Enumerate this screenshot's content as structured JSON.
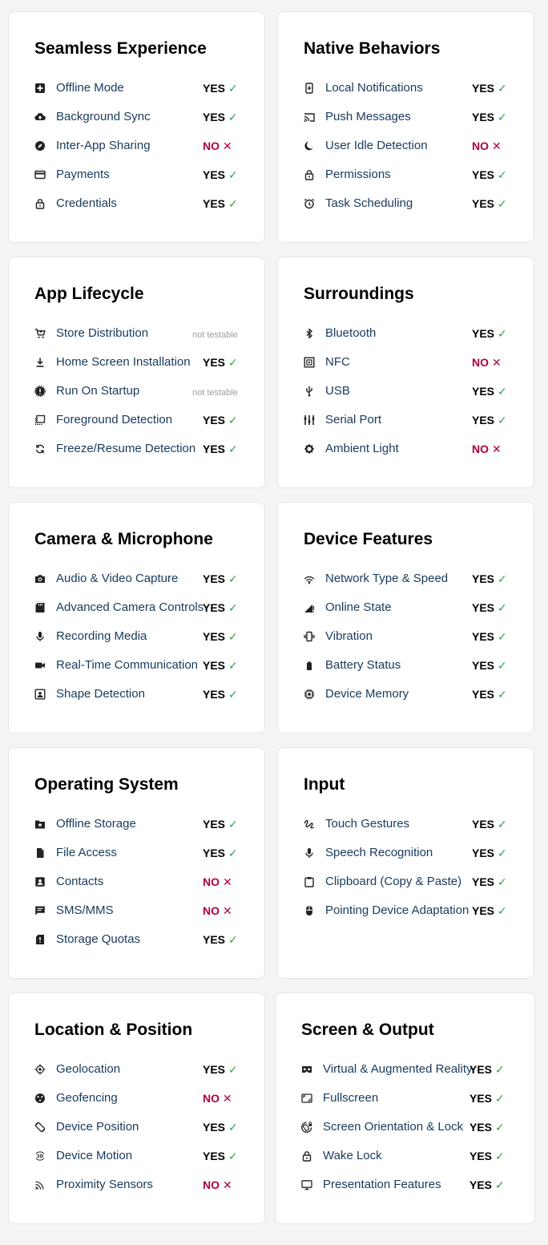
{
  "colors": {
    "yes": "#000000",
    "check": "#2e9e4f",
    "no": "#b0003a",
    "label": "#183a5c",
    "not_testable": "#9aa0a6"
  },
  "cards": [
    {
      "title": "Seamless Experience",
      "items": [
        {
          "icon": "offline-mode-icon",
          "label": "Offline Mode",
          "status": "YES",
          "mark": "✓"
        },
        {
          "icon": "cloud-upload-icon",
          "label": "Background Sync",
          "status": "YES",
          "mark": "✓"
        },
        {
          "icon": "compass-icon",
          "label": "Inter-App Sharing",
          "status": "NO",
          "mark": "✕"
        },
        {
          "icon": "credit-card-icon",
          "label": "Payments",
          "status": "YES",
          "mark": "✓"
        },
        {
          "icon": "lock-icon",
          "label": "Credentials",
          "status": "YES",
          "mark": "✓"
        }
      ]
    },
    {
      "title": "Native Behaviors",
      "items": [
        {
          "icon": "phone-notification-icon",
          "label": "Local Notifications",
          "status": "YES",
          "mark": "✓"
        },
        {
          "icon": "cast-icon",
          "label": "Push Messages",
          "status": "YES",
          "mark": "✓"
        },
        {
          "icon": "moon-icon",
          "label": "User Idle Detection",
          "status": "NO",
          "mark": "✕"
        },
        {
          "icon": "lock-icon",
          "label": "Permissions",
          "status": "YES",
          "mark": "✓"
        },
        {
          "icon": "alarm-clock-icon",
          "label": "Task Scheduling",
          "status": "YES",
          "mark": "✓"
        }
      ]
    },
    {
      "title": "App Lifecycle",
      "items": [
        {
          "icon": "cart-icon",
          "label": "Store Distribution",
          "status": "not testable",
          "mark": ""
        },
        {
          "icon": "download-icon",
          "label": "Home Screen Installation",
          "status": "YES",
          "mark": "✓"
        },
        {
          "icon": "badge-icon",
          "label": "Run On Startup",
          "status": "not testable",
          "mark": ""
        },
        {
          "icon": "window-icon",
          "label": "Foreground Detection",
          "status": "YES",
          "mark": "✓"
        },
        {
          "icon": "refresh-icon",
          "label": "Freeze/Resume Detection",
          "status": "YES",
          "mark": "✓"
        }
      ]
    },
    {
      "title": "Surroundings",
      "items": [
        {
          "icon": "bluetooth-icon",
          "label": "Bluetooth",
          "status": "YES",
          "mark": "✓"
        },
        {
          "icon": "nfc-icon",
          "label": "NFC",
          "status": "NO",
          "mark": "✕"
        },
        {
          "icon": "usb-icon",
          "label": "USB",
          "status": "YES",
          "mark": "✓"
        },
        {
          "icon": "serial-port-icon",
          "label": "Serial Port",
          "status": "YES",
          "mark": "✓"
        },
        {
          "icon": "sun-icon",
          "label": "Ambient Light",
          "status": "NO",
          "mark": "✕"
        }
      ]
    },
    {
      "title": "Camera & Microphone",
      "items": [
        {
          "icon": "camera-icon",
          "label": "Audio & Video Capture",
          "status": "YES",
          "mark": "✓"
        },
        {
          "icon": "sd-card-icon",
          "label": "Advanced Camera Controls",
          "status": "YES",
          "mark": "✓"
        },
        {
          "icon": "microphone-icon",
          "label": "Recording Media",
          "status": "YES",
          "mark": "✓"
        },
        {
          "icon": "video-camera-icon",
          "label": "Real-Time Communication",
          "status": "YES",
          "mark": "✓"
        },
        {
          "icon": "face-frame-icon",
          "label": "Shape Detection",
          "status": "YES",
          "mark": "✓"
        }
      ]
    },
    {
      "title": "Device Features",
      "items": [
        {
          "icon": "wifi-signal-icon",
          "label": "Network Type & Speed",
          "status": "YES",
          "mark": "✓"
        },
        {
          "icon": "cellular-icon",
          "label": "Online State",
          "status": "YES",
          "mark": "✓"
        },
        {
          "icon": "vibration-icon",
          "label": "Vibration",
          "status": "YES",
          "mark": "✓"
        },
        {
          "icon": "battery-icon",
          "label": "Battery Status",
          "status": "YES",
          "mark": "✓"
        },
        {
          "icon": "chip-icon",
          "label": "Device Memory",
          "status": "YES",
          "mark": "✓"
        }
      ]
    },
    {
      "title": "Operating System",
      "items": [
        {
          "icon": "folder-star-icon",
          "label": "Offline Storage",
          "status": "YES",
          "mark": "✓"
        },
        {
          "icon": "file-icon",
          "label": "File Access",
          "status": "YES",
          "mark": "✓"
        },
        {
          "icon": "contact-icon",
          "label": "Contacts",
          "status": "NO",
          "mark": "✕"
        },
        {
          "icon": "message-icon",
          "label": "SMS/MMS",
          "status": "NO",
          "mark": "✕"
        },
        {
          "icon": "storage-alert-icon",
          "label": "Storage Quotas",
          "status": "YES",
          "mark": "✓"
        }
      ]
    },
    {
      "title": "Input",
      "items": [
        {
          "icon": "gesture-icon",
          "label": "Touch Gestures",
          "status": "YES",
          "mark": "✓"
        },
        {
          "icon": "microphone-icon",
          "label": "Speech Recognition",
          "status": "YES",
          "mark": "✓"
        },
        {
          "icon": "clipboard-icon",
          "label": "Clipboard (Copy & Paste)",
          "status": "YES",
          "mark": "✓"
        },
        {
          "icon": "mouse-icon",
          "label": "Pointing Device Adaptation",
          "status": "YES",
          "mark": "✓"
        }
      ]
    },
    {
      "title": "Location & Position",
      "items": [
        {
          "icon": "crosshair-icon",
          "label": "Geolocation",
          "status": "YES",
          "mark": "✓"
        },
        {
          "icon": "geofence-icon",
          "label": "Geofencing",
          "status": "NO",
          "mark": "✕"
        },
        {
          "icon": "screen-rotation-icon",
          "label": "Device Position",
          "status": "YES",
          "mark": "✓"
        },
        {
          "icon": "rotation-3d-icon",
          "label": "Device Motion",
          "status": "YES",
          "mark": "✓"
        },
        {
          "icon": "proximity-icon",
          "label": "Proximity Sensors",
          "status": "NO",
          "mark": "✕"
        }
      ]
    },
    {
      "title": "Screen & Output",
      "items": [
        {
          "icon": "vr-headset-icon",
          "label": "Virtual & Augmented Reality",
          "status": "YES",
          "mark": "✓"
        },
        {
          "icon": "fullscreen-icon",
          "label": "Fullscreen",
          "status": "YES",
          "mark": "✓"
        },
        {
          "icon": "orientation-lock-icon",
          "label": "Screen Orientation & Lock",
          "status": "YES",
          "mark": "✓"
        },
        {
          "icon": "lock-icon",
          "label": "Wake Lock",
          "status": "YES",
          "mark": "✓"
        },
        {
          "icon": "monitor-icon",
          "label": "Presentation Features",
          "status": "YES",
          "mark": "✓"
        }
      ]
    }
  ]
}
